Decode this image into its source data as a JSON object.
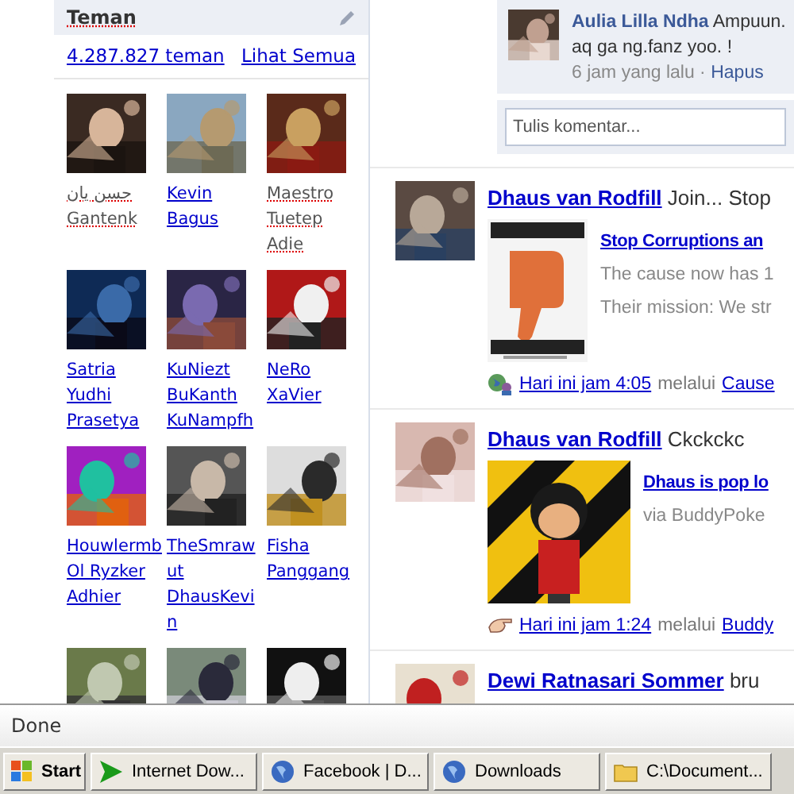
{
  "friends_panel": {
    "title": "Teman",
    "count": "4.287.827 teman",
    "see_all": "Lihat Semua",
    "friends": [
      {
        "name": "حسن يان Gantenk",
        "linked": false,
        "photo": {
          "kind": "picture"
        }
      },
      {
        "name": "Kevin Bagus",
        "linked": true,
        "photo": {
          "kind": "picture"
        }
      },
      {
        "name": "Maestro Tuetep Adie",
        "linked": false,
        "photo": {
          "kind": "picture"
        }
      },
      {
        "name": "Satria Yudhi Prasetya",
        "linked": true,
        "photo": {
          "kind": "picture"
        }
      },
      {
        "name": "KuNiezt BuKanth KuNampfh",
        "linked": true,
        "photo": {
          "kind": "picture"
        }
      },
      {
        "name": "NeRo XaVier",
        "linked": true,
        "photo": {
          "kind": "picture"
        }
      },
      {
        "name": "HouwlermbOl Ryzker Adhier",
        "linked": true,
        "photo": {
          "kind": "picture"
        }
      },
      {
        "name": "TheSmrawut DhausKevin",
        "linked": true,
        "photo": {
          "kind": "picture"
        }
      },
      {
        "name": "Fisha Panggang",
        "linked": true,
        "photo": {
          "kind": "picture"
        }
      },
      {
        "photo": {
          "kind": "picture"
        }
      },
      {
        "photo": {
          "kind": "picture"
        }
      },
      {
        "photo": {
          "kind": "picture"
        }
      }
    ]
  },
  "comment": {
    "author": "Aulia Lilla Ndha",
    "text": "Ampuun.",
    "text_2": "aq ga ng.fanz yoo. !",
    "time": "6 jam yang lalu",
    "separator": "·",
    "delete": "Hapus",
    "avatar": {
      "kind": "picture"
    }
  },
  "comment_field": {
    "placeholder": "Tulis komentar..."
  },
  "posts": [
    {
      "author": "Dhaus van Rodfill",
      "text": "Join... Stop",
      "avatar": {
        "kind": "picture"
      },
      "attachment": {
        "title": "Stop Corruptions an",
        "lines": [
          "The cause now has 1",
          "Their mission: We str"
        ],
        "kind": "poster"
      },
      "footer": {
        "time": "Hari ini jam 4:05",
        "via": "melalui",
        "app": "Cause"
      }
    },
    {
      "author": "Dhaus van Rodfill",
      "text": "Ckckckc",
      "avatar": {
        "kind": "picture"
      },
      "attachment": {
        "title": "Dhaus is pop lo",
        "lines": [
          "via BuddyPoke"
        ],
        "kind": "cartoon"
      },
      "footer": {
        "time": "Hari ini jam 1:24",
        "via": "melalui",
        "app": "Buddy"
      }
    },
    {
      "author": "Dewi Ratnasari Sommer",
      "text": "bru",
      "avatar": {
        "kind": "picture"
      }
    }
  ],
  "status_bar": {
    "text": "Done"
  },
  "taskbar": {
    "start": "Start",
    "buttons": [
      {
        "label": "Internet Dow..."
      },
      {
        "label": "Facebook | D..."
      },
      {
        "label": "Downloads"
      },
      {
        "label": "C:\\Document..."
      }
    ]
  }
}
